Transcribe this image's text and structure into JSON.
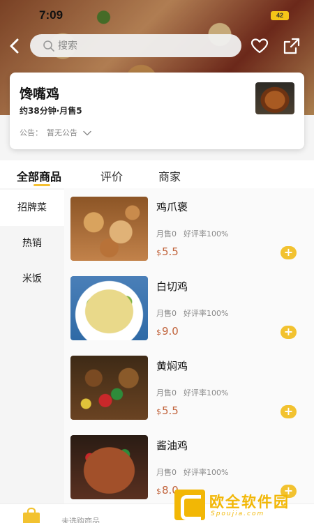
{
  "status_bar": {
    "time": "7:09",
    "battery": "42"
  },
  "search": {
    "placeholder": "搜索"
  },
  "shop": {
    "name": "馋嘴鸡",
    "meta": "约38分钟·月售5",
    "notice_label": "公告：",
    "notice_text": "暂无公告"
  },
  "tabs": [
    {
      "label": "全部商品",
      "active": true
    },
    {
      "label": "评价",
      "active": false
    },
    {
      "label": "商家",
      "active": false
    }
  ],
  "categories": [
    {
      "label": "招牌菜",
      "active": true
    },
    {
      "label": "热销",
      "active": false
    },
    {
      "label": "米饭",
      "active": false
    }
  ],
  "products": [
    {
      "name": "鸡爪褒",
      "monthly_sales": "月售0",
      "rating": "好评率100%",
      "currency": "$",
      "price": "5.5"
    },
    {
      "name": "白切鸡",
      "monthly_sales": "月售0",
      "rating": "好评率100%",
      "currency": "$",
      "price": "9.0"
    },
    {
      "name": "黄焖鸡",
      "monthly_sales": "月售0",
      "rating": "好评率100%",
      "currency": "$",
      "price": "5.5"
    },
    {
      "name": "酱油鸡",
      "monthly_sales": "月售0",
      "rating": "好评率100%",
      "currency": "$",
      "price": "8.0"
    }
  ],
  "cart": {
    "empty_text": "未选购商品",
    "add_symbol": "+"
  },
  "watermark": {
    "brand": "欧全软件园",
    "site": "Spoujia.com"
  },
  "colors": {
    "accent": "#f2c230",
    "price": "#c0623a"
  }
}
